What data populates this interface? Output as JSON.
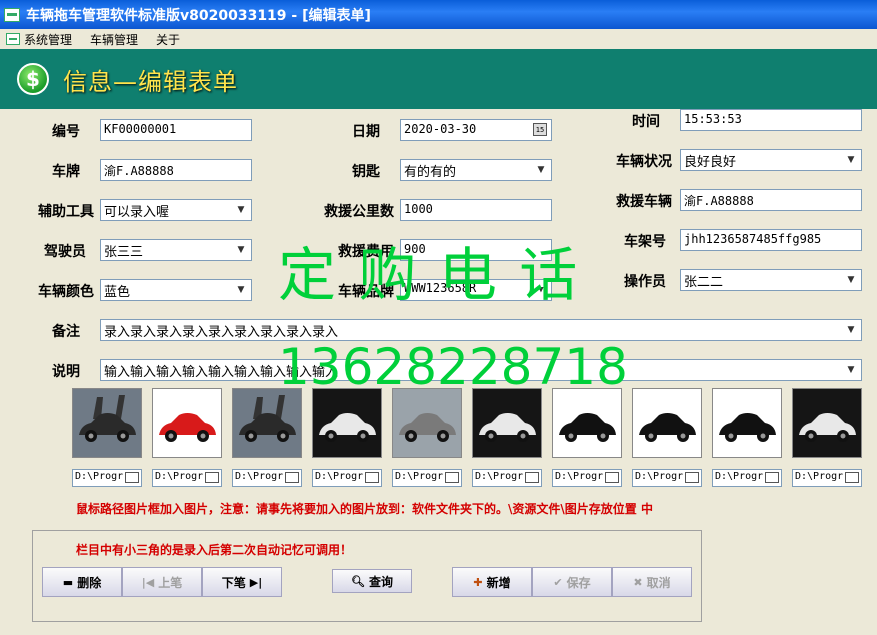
{
  "window": {
    "title": "车辆拖车管理软件标准版v8020033119 - [编辑表单]"
  },
  "menu": [
    "系统管理",
    "车辆管理",
    "关于"
  ],
  "header": {
    "title": "信息—编辑表单"
  },
  "form": {
    "bianhao_label": "编号",
    "bianhao": "KF00000001",
    "riqi_label": "日期",
    "riqi": "2020-03-30",
    "shijian_label": "时间",
    "shijian": "15:53:53",
    "chepai_label": "车牌",
    "chepai": "渝F.A88888",
    "yaoshi_label": "钥匙",
    "yaoshi": "有的有的",
    "zhuangkuang_label": "车辆状况",
    "zhuangkuang": "良好良好",
    "fuzhu_label": "辅助工具",
    "fuzhu": "可以录入喔",
    "gonglishu_label": "救援公里数",
    "gonglishu": "1000",
    "jiuyuancheliang_label": "救援车辆",
    "jiuyuancheliang": "渝F.A88888",
    "jiashiyuan_label": "驾驶员",
    "jiashiyuan": "张三三",
    "feiyong_label": "救援费用",
    "feiyong": "900",
    "chejiahao_label": "车架号",
    "chejiahao": "jhh1236587485ffg985",
    "yanse_label": "车辆颜色",
    "yanse": "蓝色",
    "pinpai_label": "车辆品牌",
    "pinpai": "WWW123658R",
    "caozuoyuan_label": "操作员",
    "caozuoyuan": "张二二",
    "beizhu_label": "备注",
    "beizhu": "录入录入录入录入录入录入录入录入录入",
    "shuoming_label": "说明",
    "shuoming": "输入输入输入输入输入输入输入输入输入"
  },
  "images": {
    "paths": [
      "D:\\Progr",
      "D:\\Progr",
      "D:\\Progr",
      "D:\\Progr",
      "D:\\Progr",
      "D:\\Progr",
      "D:\\Progr",
      "D:\\Progr",
      "D:\\Progr",
      "D:\\Progr"
    ]
  },
  "notes": {
    "image_hint": "鼠标路径图片框加入图片，注意：请事先将要加入的图片放到：软件文件夹下的。\\资源文件\\图片存放位置 中",
    "memory_hint": "栏目中有小三角的是录入后第二次自动记忆可调用！"
  },
  "buttons": {
    "delete": "删除",
    "prev": "上笔",
    "next": "下笔",
    "query": "查询",
    "add": "新增",
    "save": "保存",
    "cancel": "取消"
  },
  "watermark": {
    "line1": "定 购 电 话",
    "line2": "13628228718"
  },
  "colors": {
    "header_bg": "#0f7f6f",
    "header_title": "#ffe44c",
    "watermark": "#00d03a",
    "note_red": "#d40000"
  }
}
